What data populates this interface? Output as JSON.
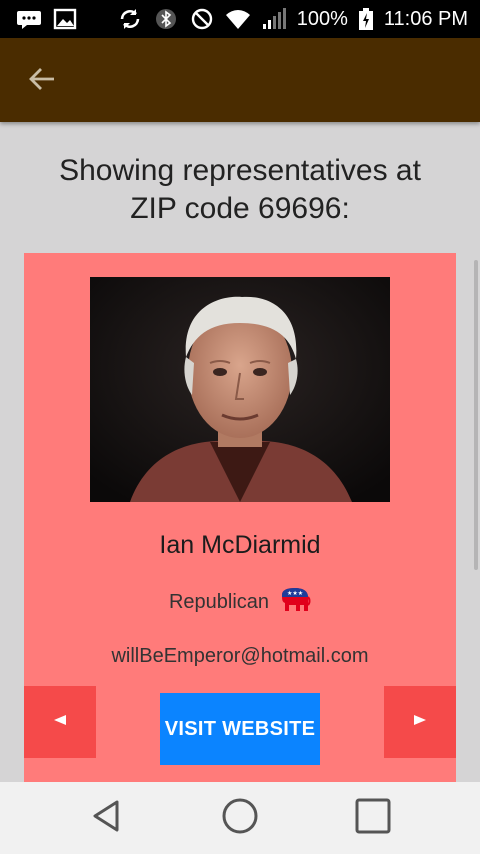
{
  "status_bar": {
    "battery_percent": "100%",
    "time": "11:06 PM"
  },
  "headline": {
    "line1": "Showing representatives at",
    "line2": "ZIP code 69696:"
  },
  "representative": {
    "name": "Ian McDiarmid",
    "party": "Republican",
    "email": "willBeEmperor@hotmail.com",
    "visit_label": "VISIT WEBSITE"
  },
  "colors": {
    "app_bar": "#4a2c00",
    "card": "#ff7b7a",
    "nav_button": "#f54a4a",
    "visit_button": "#0b84ff"
  }
}
